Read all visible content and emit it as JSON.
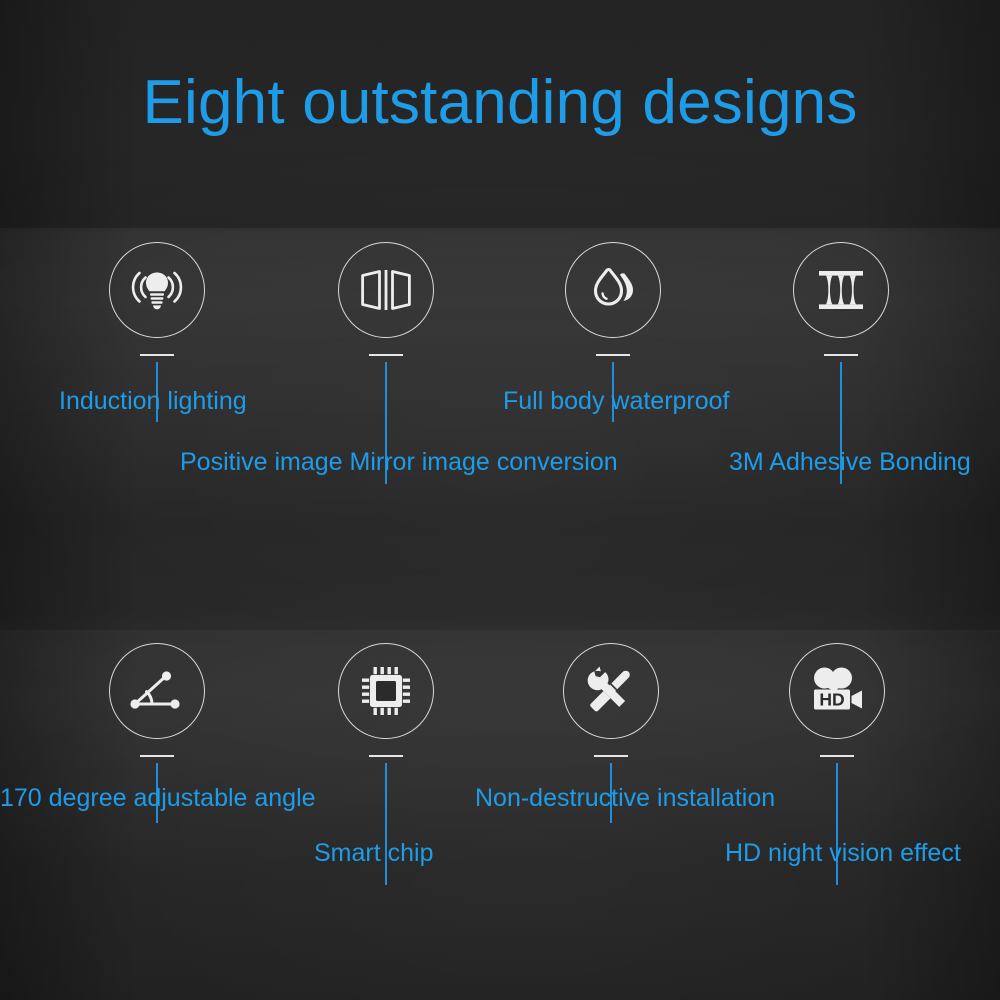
{
  "page": {
    "title": "Eight outstanding designs",
    "accent_color": "#1e9ce8",
    "icon_color": "#e6e6e6",
    "background_color": "#242424"
  },
  "features": [
    {
      "id": "induction-lighting",
      "icon": "lightbulb-waves-icon",
      "label": "Induction lighting"
    },
    {
      "id": "mirror-conversion",
      "icon": "mirror-panels-icon",
      "label": "Positive image Mirror image conversion"
    },
    {
      "id": "waterproof",
      "icon": "water-droplets-icon",
      "label": "Full body waterproof"
    },
    {
      "id": "adhesive-bonding",
      "icon": "adhesive-spool-icon",
      "label": "3M Adhesive Bonding"
    },
    {
      "id": "adjustable-angle",
      "icon": "angle-triangle-icon",
      "label": "170 degree adjustable angle"
    },
    {
      "id": "smart-chip",
      "icon": "cpu-chip-icon",
      "label": "Smart chip"
    },
    {
      "id": "non-destructive-installation",
      "icon": "wrench-screwdriver-icon",
      "label": "Non-destructive installation"
    },
    {
      "id": "hd-night-vision",
      "icon": "hd-video-camera-icon",
      "label": "HD night vision effect"
    }
  ]
}
